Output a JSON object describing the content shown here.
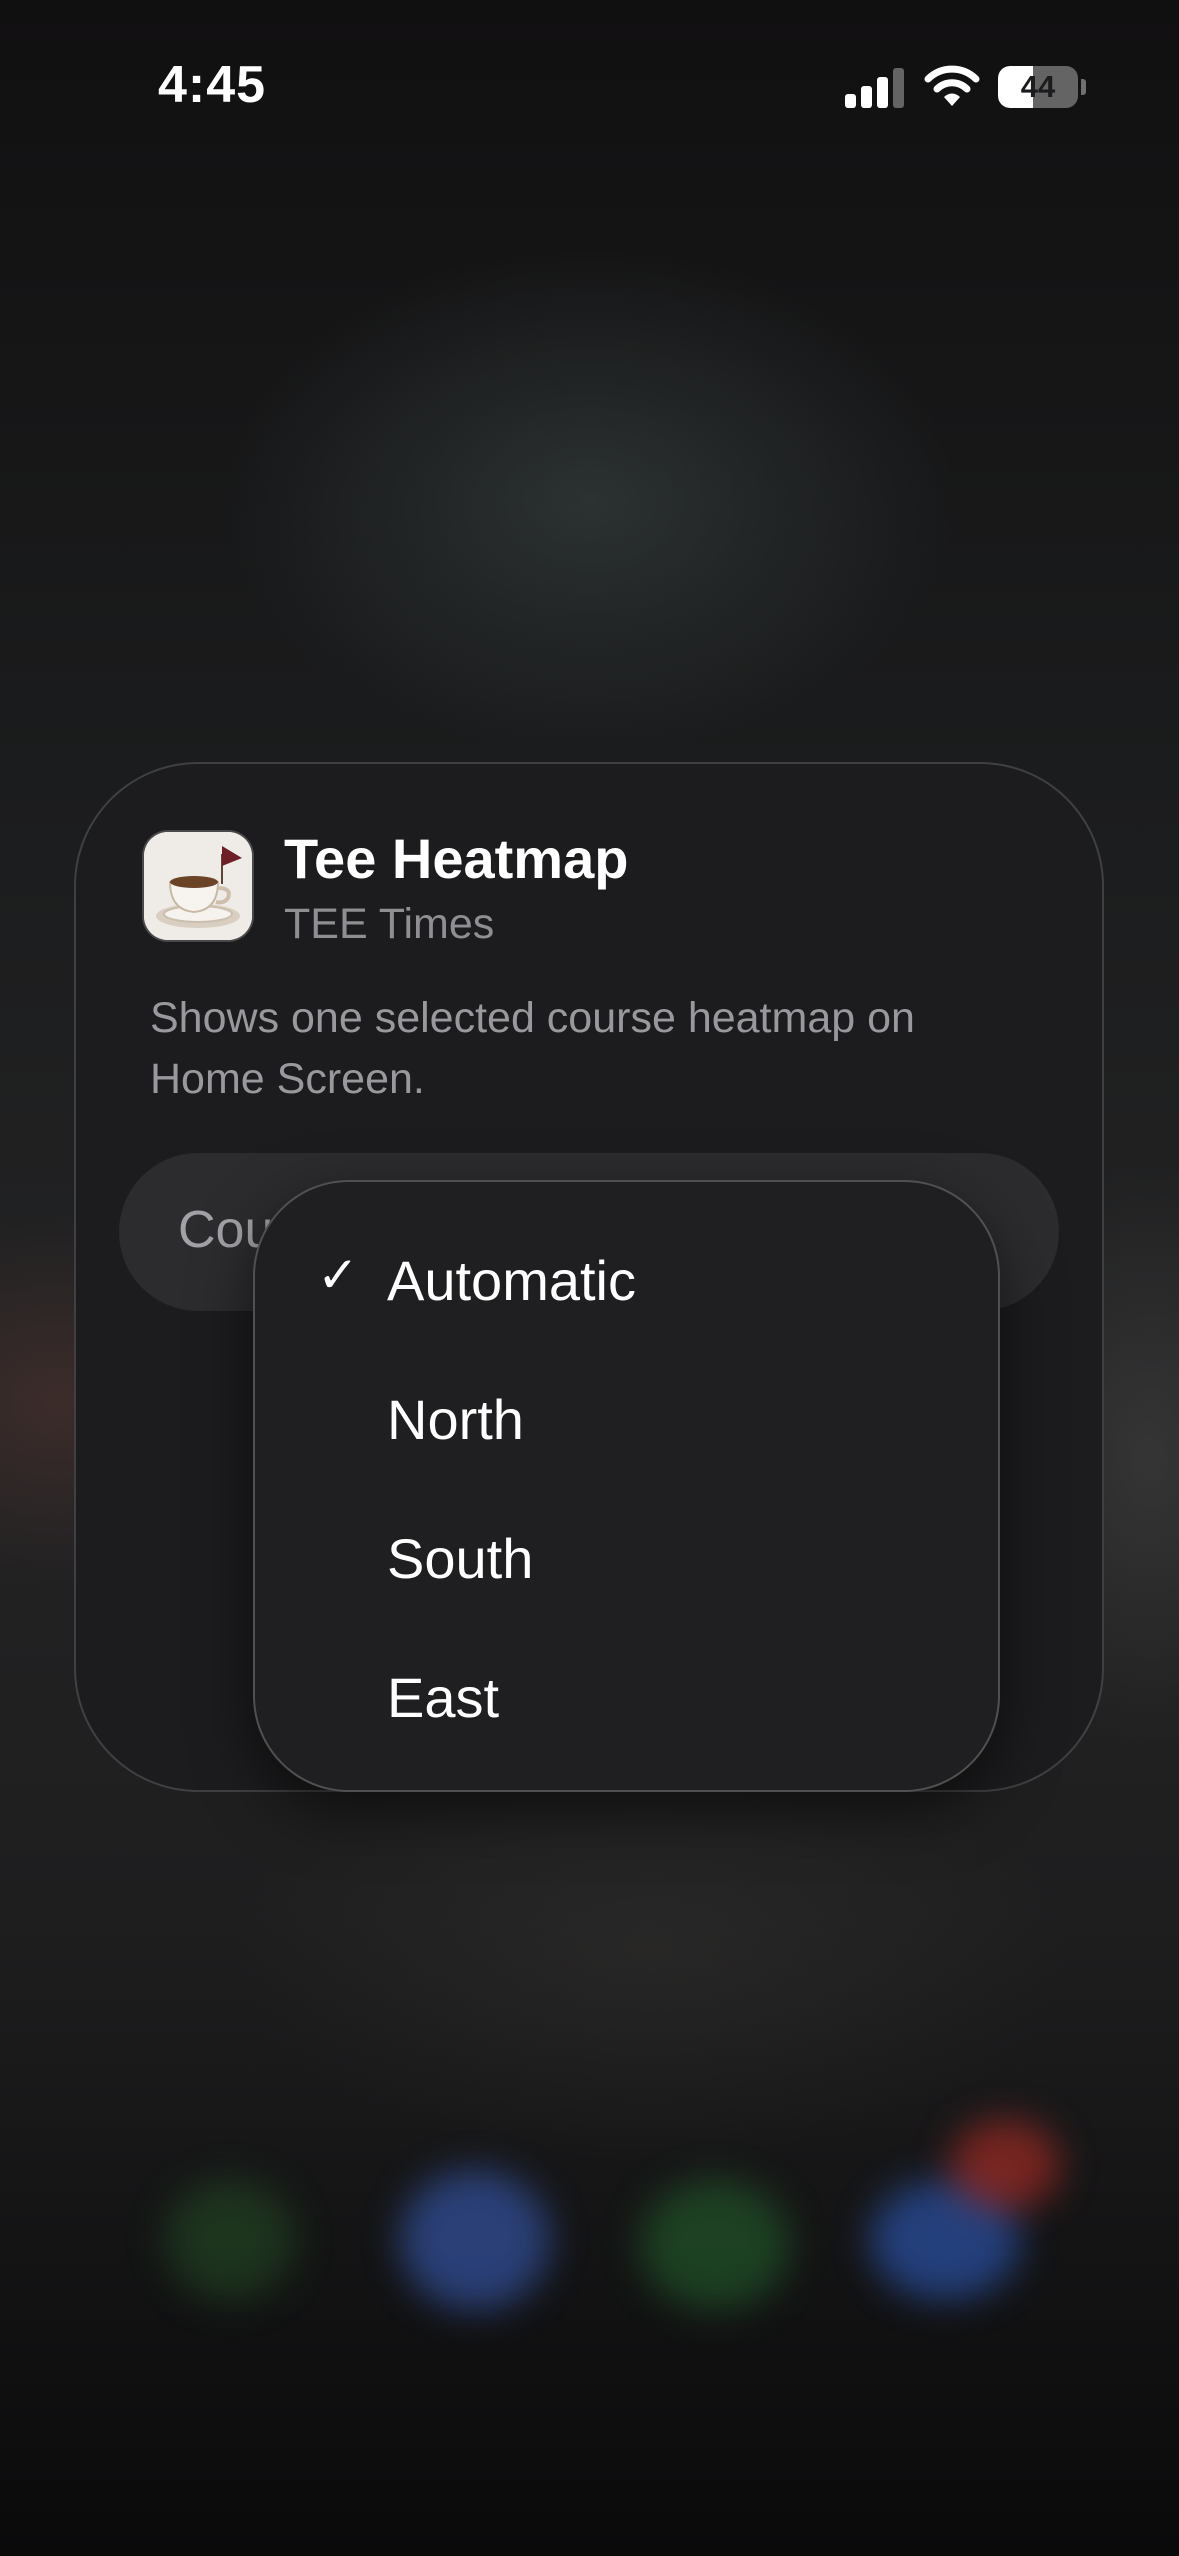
{
  "status_bar": {
    "time": "4:45",
    "battery_level": "44",
    "battery_fraction": 0.44,
    "icons": [
      "cellular-signal-icon",
      "wifi-icon",
      "battery-icon"
    ]
  },
  "widget": {
    "title": "Tee Heatmap",
    "app_name": "TEE Times",
    "description": "Shows one selected course heatmap on Home Screen.",
    "parameter_label": "Cou",
    "app_icon": "coffee-cup-flag-icon"
  },
  "menu": {
    "options": [
      {
        "label": "Automatic",
        "selected": true
      },
      {
        "label": "North",
        "selected": false
      },
      {
        "label": "South",
        "selected": false
      },
      {
        "label": "East",
        "selected": false
      }
    ],
    "check_glyph": "✓"
  },
  "colors": {
    "card_background": "#1c1c1e",
    "menu_background": "#1f1f21",
    "secondary_text": "#8e8e93"
  }
}
